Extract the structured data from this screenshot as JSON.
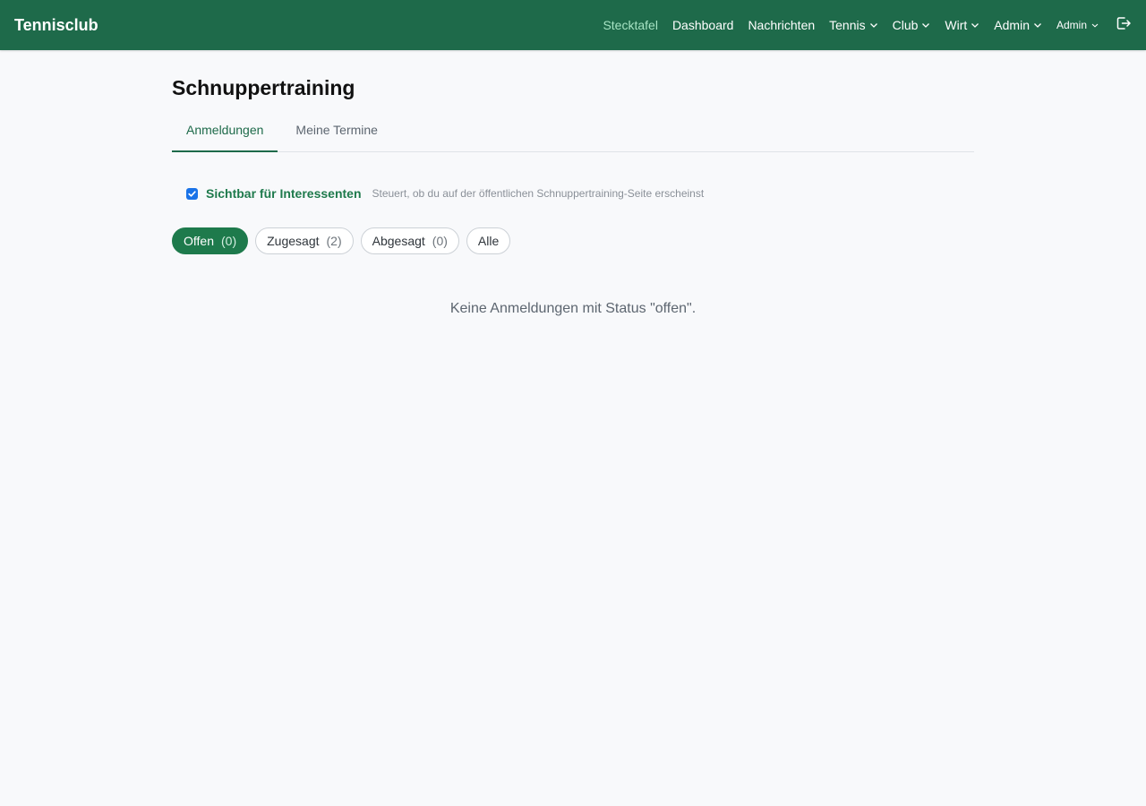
{
  "brand": "Tennisclub",
  "nav": {
    "stecktafel": "Stecktafel",
    "dashboard": "Dashboard",
    "nachrichten": "Nachrichten",
    "tennis": "Tennis",
    "club": "Club",
    "wirt": "Wirt",
    "admin_menu": "Admin",
    "user": "Admin"
  },
  "page": {
    "title": "Schnuppertraining"
  },
  "tabs": [
    {
      "label": "Anmeldungen",
      "active": true
    },
    {
      "label": "Meine Termine",
      "active": false
    }
  ],
  "visibility": {
    "checked": true,
    "label": "Sichtbar für Interessenten",
    "hint": "Steuert, ob du auf der öffentlichen Schnuppertraining-Seite erscheinst"
  },
  "filters": [
    {
      "label": "Offen",
      "count": "(0)",
      "active": true
    },
    {
      "label": "Zugesagt",
      "count": "(2)",
      "active": false
    },
    {
      "label": "Abgesagt",
      "count": "(0)",
      "active": false
    },
    {
      "label": "Alle",
      "count": null,
      "active": false
    }
  ],
  "empty_message": "Keine Anmeldungen mit Status \"offen\".",
  "colors": {
    "primary": "#1e6a4a",
    "accent_active_nav": "#a6e3c3",
    "pill_active": "#1e7a4c",
    "checkbox": "#1a73e8"
  }
}
